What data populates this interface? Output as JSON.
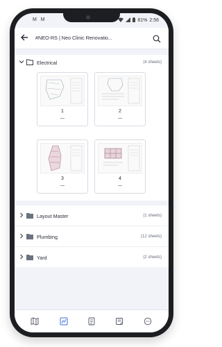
{
  "status_bar": {
    "time": "2:56",
    "battery": "81%",
    "left_icons": "M M"
  },
  "app_bar": {
    "title": "#NEO-RS | Neo Clinic Renovatio..."
  },
  "sections": {
    "electrical": {
      "label": "Electrical",
      "count": "(4 sheets)",
      "sheets": [
        {
          "number": "1",
          "subtitle": "—"
        },
        {
          "number": "2",
          "subtitle": "—"
        },
        {
          "number": "3",
          "subtitle": "—"
        },
        {
          "number": "4",
          "subtitle": "—"
        }
      ]
    },
    "layout_master": {
      "label": "Layout Master",
      "count": "(1 sheets)"
    },
    "plumbing": {
      "label": "Plumbing",
      "count": "(12 sheets)"
    },
    "yard": {
      "label": "Yard",
      "count": "(2 sheets)"
    }
  },
  "bottom_nav": [
    "map-icon",
    "plans-icon",
    "checklist-icon",
    "notes-icon",
    "chat-icon"
  ],
  "colors": {
    "accent": "#3b6fd8",
    "text": "#2b2f3a",
    "background": "#f1f3f8"
  }
}
